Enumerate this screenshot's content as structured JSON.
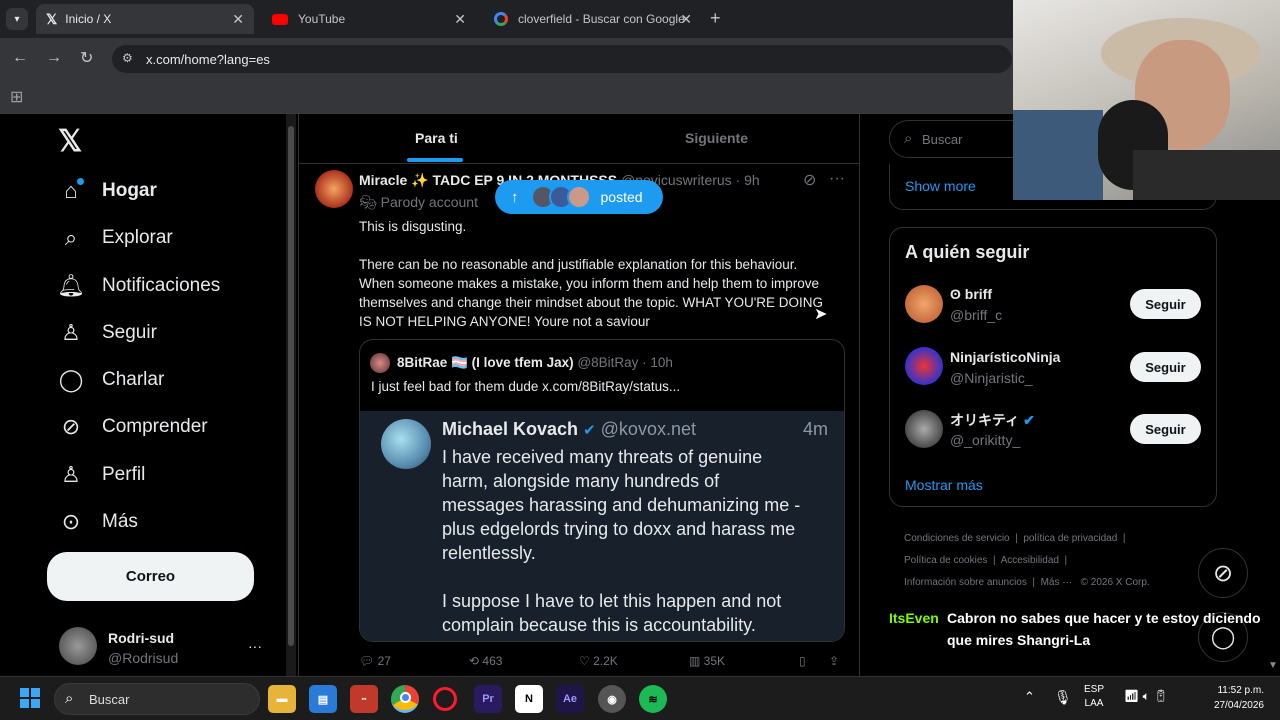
{
  "browser": {
    "tabs": [
      {
        "title": "Inicio / X",
        "icon": "x-logo-icon",
        "close": "✕"
      },
      {
        "title": "YouTube",
        "icon": "youtube-icon",
        "close": "✕"
      },
      {
        "title": "cloverfield - Buscar con Google",
        "icon": "google-icon",
        "close": "✕"
      }
    ],
    "new_tab": "+",
    "url": "x.com/home?lang=es"
  },
  "sidebar": {
    "logo": "𝕏",
    "items": [
      {
        "label": "Hogar",
        "icon": "home-icon",
        "glyph": "⌂"
      },
      {
        "label": "Explorar",
        "icon": "search-icon",
        "glyph": "⌕"
      },
      {
        "label": "Notificaciones",
        "icon": "bell-icon",
        "glyph": "♫"
      },
      {
        "label": "Seguir",
        "icon": "add-person-icon",
        "glyph": "♙"
      },
      {
        "label": "Charlar",
        "icon": "chat-icon",
        "glyph": "◯"
      },
      {
        "label": "Comprender",
        "icon": "grok-icon",
        "glyph": "⊘"
      },
      {
        "label": "Perfil",
        "icon": "person-icon",
        "glyph": "♙"
      },
      {
        "label": "Más",
        "icon": "more-circle-icon",
        "glyph": "⊙"
      }
    ],
    "post_button": "Correo",
    "account": {
      "name": "Rodri-sud",
      "handle": "@Rodrisud",
      "more": "···"
    }
  },
  "feed": {
    "tabs": [
      "Para ti",
      "Siguiente"
    ],
    "posted_pill": {
      "label": "posted",
      "arrow": "↑"
    },
    "post": {
      "author": "Miracle ✨ TADC EP 9 IN 2 MONTHSSS",
      "handle": "@novicuswriterus",
      "time": "· 9h",
      "badge": "Parody account",
      "lines": [
        "This is disgusting.",
        "There can be no reasonable and justifiable explanation for this behaviour.",
        "When someone makes a mistake, you inform them and help them to improve",
        "themselves and change their mindset about the topic. WHAT YOU'RE DOING",
        "IS NOT HELPING ANYONE! Youre not a saviour"
      ],
      "quote": {
        "author": "8BitRae 🏳️‍⚧️ (I love tfem Jax)",
        "handle": "@8BitRay · 10h",
        "text": "I just feel bad for them dude  x.com/8BitRay/status..."
      },
      "embedded": {
        "name": "Michael Kovach",
        "handle": "@kovox.net",
        "time": "4m",
        "lines": [
          "I have received many threats of genuine",
          "harm, alongside many hundreds of",
          "messages harassing and dehumanizing me -",
          "plus edgelords trying to doxx and harass me",
          "relentlessly.",
          "I suppose I have to let this happen and not",
          "complain because this is accountability."
        ]
      },
      "stats": {
        "replies": "27",
        "reposts": "463",
        "likes": "2.2K",
        "views": "35K"
      }
    }
  },
  "right": {
    "search_placeholder": "Buscar",
    "show_more": "Show more",
    "who_to_follow": {
      "title": "A quién seguir",
      "users": [
        {
          "name": "ʘ briff",
          "handle": "@briff_c",
          "button": "Seguir"
        },
        {
          "name": "NinjarísticoNinja",
          "handle": "@Ninjaristic_",
          "button": "Seguir"
        },
        {
          "name": "オリキティ",
          "handle": "@_orikitty_",
          "button": "Seguir"
        }
      ],
      "more": "Mostrar más"
    },
    "footer": [
      "Condiciones de servicio",
      "|",
      "política de privacidad",
      "|",
      "Política de cookies",
      "|",
      "Accesibilidad",
      "|",
      "Información sobre anuncios",
      "|",
      "Más ···",
      "© 2026 X Corp."
    ]
  },
  "chat_overlay": {
    "user": "ItsEven",
    "message_line1": "Cabron no sabes que hacer y te estoy diciendo",
    "message_line2": "que mires Shangri-La"
  },
  "taskbar": {
    "search": "Buscar",
    "lang": "ESP",
    "lang_sub": "LAA",
    "time": "11:52 p.m.",
    "date": "27/04/2026",
    "apps": [
      "Pr",
      "N",
      "Ae"
    ]
  },
  "colors": {
    "accent": "#1d9bf0",
    "bg": "#000000",
    "border": "#2f3336",
    "chat_user": "#7cfc00"
  }
}
